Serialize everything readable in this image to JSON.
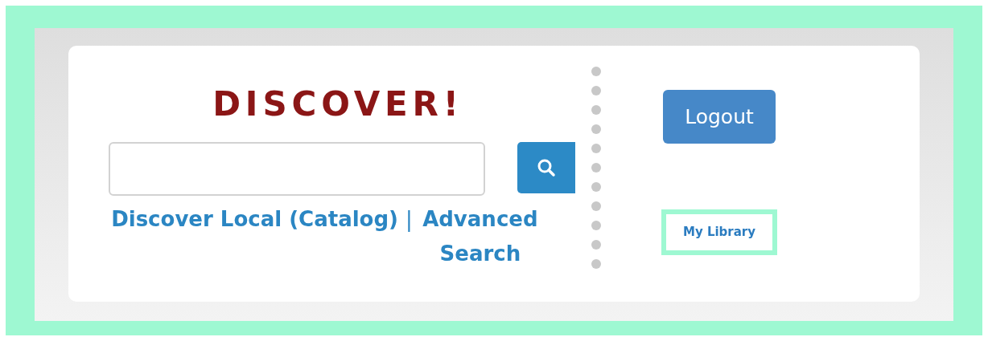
{
  "title": "DISCOVER!",
  "links": [
    {
      "kind": "link",
      "label": "Discover Local (Catalog)"
    },
    {
      "kind": "separator",
      "label": "|"
    },
    {
      "kind": "link",
      "label": "Advanced Search"
    }
  ],
  "logout_button": {
    "label": "Logout"
  },
  "my_library": {
    "label": "My Library"
  }
}
